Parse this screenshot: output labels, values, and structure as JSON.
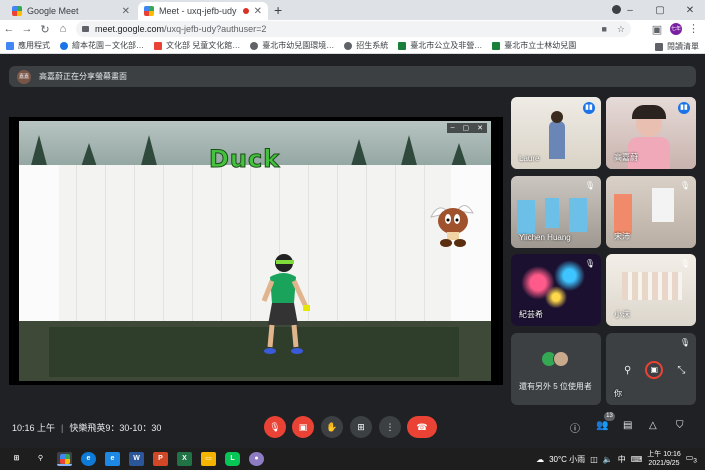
{
  "browser": {
    "tabs": [
      {
        "title": "Google Meet",
        "close": "✕"
      },
      {
        "title": "Meet - uxq-jefb-udy",
        "close": "✕"
      }
    ],
    "new_tab": "+",
    "window_controls": [
      "–",
      "▢",
      "✕"
    ],
    "url_host": "meet.google.com",
    "url_rest": "/uxq-jefb-udy?authuser=2",
    "profile_avatar": "七年",
    "bookmarks": [
      {
        "label": "應用程式",
        "color": "#4285f4"
      },
      {
        "label": "繪本花園－文化部…",
        "color": "#1a73e8"
      },
      {
        "label": "文化部 兒童文化館…",
        "color": "#ea4335"
      },
      {
        "label": "臺北市幼兒園環境…",
        "color": "#5f6368"
      },
      {
        "label": "招生系統",
        "color": "#5f6368"
      },
      {
        "label": "臺北市公立及非營…",
        "color": "#188038"
      },
      {
        "label": "臺北市立士林幼兒園",
        "color": "#188038"
      }
    ],
    "reading_list": "閱讀清單"
  },
  "meet": {
    "presenting": {
      "avatar": "嘉嘉",
      "text": "高嘉蔚正在分享螢幕畫面"
    },
    "stage": {
      "video_title": "Duck",
      "player_controls": [
        "–",
        "▢",
        "✕"
      ]
    },
    "participants": [
      {
        "name": "Laure",
        "badge": "speaking",
        "bg": "#e9e6df"
      },
      {
        "name": "高嘉蔚",
        "badge": "speaking",
        "bg": "#d9c6c2",
        "active": true
      },
      {
        "name": "Yiichen Huang",
        "badge": "muted",
        "bg": "#b8b3ae"
      },
      {
        "name": "宋沛",
        "badge": "muted",
        "bg": "#cfc4bb"
      },
      {
        "name": "紀芸希",
        "badge": "muted",
        "bg": "#2a1c3a"
      },
      {
        "name": "小沫",
        "badge": "muted",
        "bg": "#e8e4dc"
      }
    ],
    "more": {
      "text": "還有另外 5 位使用者"
    },
    "self": {
      "name": "你"
    },
    "time": "10:16 上午",
    "meeting_name": "快樂飛英9：30-10：30",
    "people_count": "13"
  },
  "taskbar": {
    "weather": "30°C 小雨",
    "ime": "中",
    "time": "上午 10:16",
    "date": "2021/9/25",
    "notifications": "3"
  }
}
